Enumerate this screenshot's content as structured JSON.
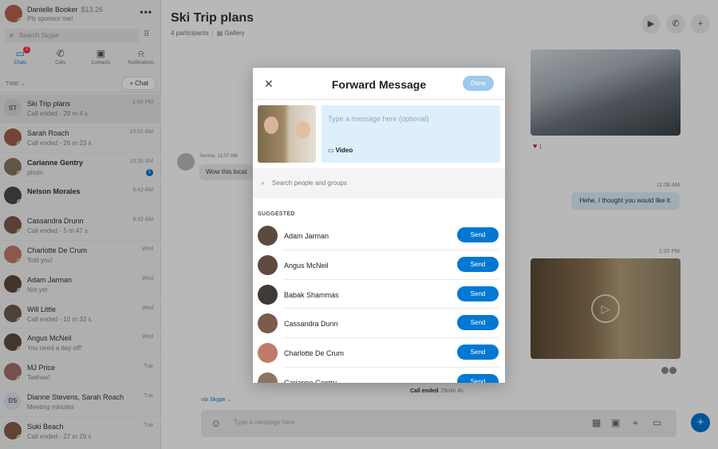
{
  "profile": {
    "name": "Danielle Booker",
    "credit": "$13.26",
    "mood": "Pls sponsor me!",
    "avatar_color": "#b4634f"
  },
  "search": {
    "placeholder": "Search Skype"
  },
  "nav_tabs": [
    {
      "label": "Chats",
      "icon": "chat-icon",
      "badge": "2"
    },
    {
      "label": "Calls",
      "icon": "phone-icon"
    },
    {
      "label": "Contacts",
      "icon": "contacts-icon"
    },
    {
      "label": "Notifications",
      "icon": "bell-icon"
    }
  ],
  "sort_label": "TIME",
  "new_chat_label": "Chat",
  "chats": [
    {
      "name": "Ski Trip plans",
      "initials": "ST",
      "preview": "Call ended - 29 m 4 s",
      "time": "1:40 PM",
      "color": "#d8d8d8"
    },
    {
      "name": "Sarah Roach",
      "preview": "Call ended - 26 m 23 s",
      "time": "10:51 AM",
      "color": "#a0604c"
    },
    {
      "name": "Carianne Gentry",
      "preview": "photo",
      "time": "10:30 AM",
      "unread": "1",
      "color": "#8a7562"
    },
    {
      "name": "Nelson Morales",
      "preview": "",
      "time": "9:42 AM",
      "color": "#4a4a4a"
    },
    {
      "name": "Cassandra Drunn",
      "preview": "Call ended - 5 m 47 s",
      "time": "9:42 AM",
      "color": "#7a5b4c"
    },
    {
      "name": "Charlotte De Crum",
      "preview": "Told you!",
      "time": "Wed",
      "color": "#c07a6a"
    },
    {
      "name": "Adam Jarman",
      "preview": "Not yet",
      "time": "Wed",
      "color": "#5d4a3e"
    },
    {
      "name": "Will Little",
      "preview": "Call ended - 10 m 32 s",
      "time": "Wed",
      "color": "#6e5b4a"
    },
    {
      "name": "Angus McNeil",
      "preview": "You need a day off!",
      "time": "Wed",
      "color": "#5f4a40"
    },
    {
      "name": "MJ Price",
      "preview": "Teehee!",
      "time": "Tue",
      "color": "#a4706a"
    },
    {
      "name": "Dianne Stevens, Sarah Roach",
      "initials": "DS",
      "preview": "Meeting minutes",
      "time": "Tue",
      "color": "#dde6f0"
    },
    {
      "name": "Suki Beach",
      "preview": "Call ended - 27 m 29 s",
      "time": "Tue",
      "color": "#8a5a48"
    }
  ],
  "conversation": {
    "title": "Ski Trip plans",
    "participants": "4 participants",
    "gallery": "Gallery",
    "reaction_count": "1",
    "incoming_meta": "Serena, 11:07 AM",
    "incoming_text": "Wow this locat",
    "outgoing_time": "11:08 AM",
    "outgoing_text": "Hehe, I thought you would like it.",
    "video_time": "1:20 PM",
    "call_ended_label": "Call ended",
    "call_ended_duration": "29min 4s",
    "via_label": "via",
    "via_service": "Skype",
    "composer_placeholder": "Type a message here"
  },
  "modal": {
    "title": "Forward Message",
    "done_label": "Done",
    "message_placeholder": "Type a message here (optional)",
    "attachment_label": "Video",
    "search_placeholder": "Search people and groups",
    "suggested_label": "SUGGESTED",
    "send_label": "Send",
    "contacts": [
      {
        "name": "Adam Jarman",
        "color": "#5d4a3e"
      },
      {
        "name": "Angus McNeil",
        "color": "#5f4a40"
      },
      {
        "name": "Babak Shammas",
        "color": "#3f3a36"
      },
      {
        "name": "Cassandra Dunn",
        "color": "#7a5b4c"
      },
      {
        "name": "Charlotte De Crum",
        "color": "#c07a6a"
      },
      {
        "name": "Carianne Gentry",
        "color": "#8a7562"
      }
    ]
  },
  "colors": {
    "accent": "#0078d4",
    "online": "#40b040",
    "unread": "#0078d4"
  }
}
